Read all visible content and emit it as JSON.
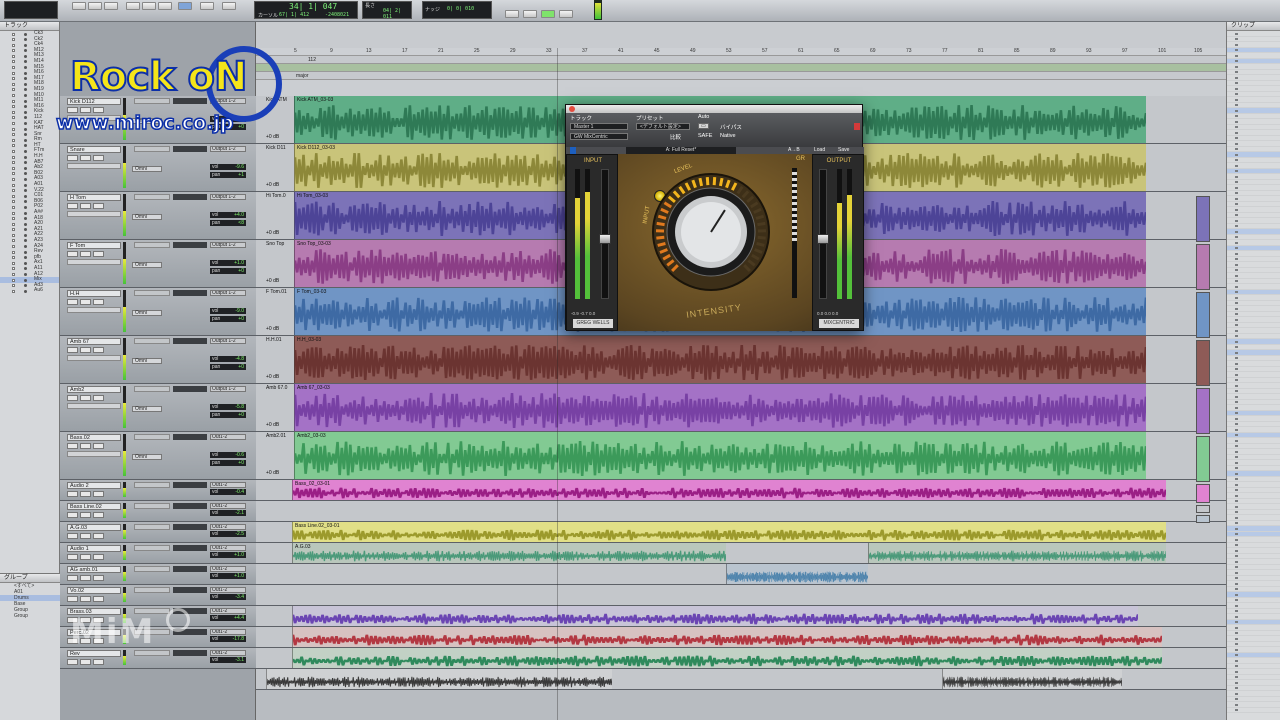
{
  "transport": {
    "counter_main": "34| 1| 047",
    "counter_label": "カーソル",
    "counter_pos": "67| 1| 412",
    "sample_value": "-2408021",
    "length_label": "長さ",
    "length_value": "04| 2| 011",
    "nudge_label": "ナッジ",
    "nudge_value": "0| 0| 010"
  },
  "panels": {
    "tracks_title": "トラック",
    "groups_title": "グループ",
    "clips_title": "クリップ"
  },
  "track_list": [
    "Ck3",
    "Ck2",
    "Ck4",
    "M12",
    "M13",
    "M14",
    "M15",
    "M16",
    "M17",
    "M18",
    "M19",
    "M10",
    "M11",
    "M16",
    "Kick",
    "112",
    "KAT",
    "HAT",
    "Snr",
    "Rm",
    "HT",
    "FTm",
    "H.H",
    "AB7",
    "Ab2",
    "B02",
    "A03",
    "A01",
    "V.22",
    "C01",
    "B06",
    "P02",
    "A##",
    "A18",
    "A20",
    "A21",
    "A22",
    "A23",
    "A24",
    "Rev",
    "pfb",
    "Ax1",
    "A11",
    "A12",
    "Mix",
    "Ad3",
    "Au6"
  ],
  "groups": [
    "<すべて>",
    "A01",
    "Drums",
    "Base",
    "Group",
    "Group"
  ],
  "strips": [
    {
      "name": "Kick D112",
      "out": "Output 1-2",
      "vol": "-11.8",
      "pan": "+0"
    },
    {
      "name": "Snare",
      "out": "Output 1-2",
      "vol": "-9.6",
      "pan": "+1"
    },
    {
      "name": "H Tom",
      "out": "Output 1-2",
      "vol": "+4.0",
      "pan": "<8"
    },
    {
      "name": "F Tom",
      "out": "Output 1-2",
      "vol": "+1.0",
      "pan": "+0"
    },
    {
      "name": "H.H",
      "out": "Output 1-2",
      "vol": "-9.0",
      "pan": "+0"
    },
    {
      "name": "Amb 67",
      "out": "Output 1-2",
      "vol": "-4.8",
      "pan": "+0"
    },
    {
      "name": "Amb2",
      "out": "Output 1-2",
      "vol": "-5.8",
      "pan": "+0"
    },
    {
      "name": "Bass.02",
      "out": "Out1-2",
      "vol": "-0.6",
      "pan": "+0"
    },
    {
      "name": "Audio 2",
      "out": "Out1-2",
      "vol": "-0.4",
      "pan": "+0"
    },
    {
      "name": "Bass Line.02",
      "out": "Out1-2",
      "vol": "-2.1",
      "pan": "+0"
    },
    {
      "name": "A.G.03",
      "out": "Out1-2",
      "vol": "-2.5",
      "pan": "+0"
    },
    {
      "name": "Audio 1",
      "out": "Out1-2",
      "vol": "+1.0",
      "pan": "100"
    },
    {
      "name": "AG amb.01",
      "out": "Out1-2",
      "vol": "+1.0",
      "pan": "100"
    },
    {
      "name": "Vo.02",
      "out": "Out1-2",
      "vol": "-3.4",
      "pan": "+0"
    },
    {
      "name": "Brass.03",
      "out": "Out1-2",
      "vol": "+4.4",
      "pan": "+0"
    },
    {
      "name": "Perc.02",
      "out": "Out1-2",
      "vol": "-17.8",
      "pan": "+0"
    },
    {
      "name": "Rev",
      "out": "Out1-2",
      "vol": "-3.1",
      "pan": "+0"
    }
  ],
  "track_clips": [
    {
      "label": "Kick ATM",
      "clip": "Kick ATM_03-03",
      "color": "#5fae87",
      "wave": "#2f7a56",
      "h": 48
    },
    {
      "label": "Kick D11",
      "clip": "Kick D112_03-03",
      "color": "#c9c47a",
      "wave": "#8d8839",
      "h": 48
    },
    {
      "label": "Hi Tom.0",
      "clip": "Hi Tom_03-03",
      "color": "#7c73b8",
      "wave": "#4d4497",
      "h": 48
    },
    {
      "label": "Sno Top",
      "clip": "Sno Top_03-03",
      "color": "#b67bb0",
      "wave": "#8b3e86",
      "h": 48
    },
    {
      "label": "F Tom.01",
      "clip": "F Tom_03-03",
      "color": "#7095c5",
      "wave": "#3e6aa4",
      "h": 48
    },
    {
      "label": "H.H.01",
      "clip": "H.H_03-03",
      "color": "#8e5b57",
      "wave": "#6b3431",
      "h": 48
    },
    {
      "label": "Amb 67.0",
      "clip": "Amb 67_03-03",
      "color": "#a472c6",
      "wave": "#7841a4",
      "h": 48
    },
    {
      "label": "Amb2.01",
      "clip": "Amb2_03-03",
      "color": "#82ca93",
      "wave": "#3c9a5a",
      "h": 48
    },
    {
      "label": "",
      "clip": "Bass_02_03-01",
      "color": "#e083d1",
      "wave": "#9b1f86",
      "h": 21
    },
    {
      "label": "",
      "clip": "",
      "color": "#c4c7cb",
      "wave": "#c4c7cb",
      "h": 21
    },
    {
      "label": "",
      "clip": "Bass Line.02_03-01",
      "color": "#e1df87",
      "wave": "#9c9a2c",
      "h": 21
    },
    {
      "label": "",
      "clip": "A.G.03",
      "color": "#b9c7bc",
      "wave": "#4b9a7a",
      "h": 21
    },
    {
      "label": "",
      "clip": "",
      "color": "#b9c4cf",
      "wave": "#3b79a6",
      "h": 21
    },
    {
      "label": "",
      "clip": "",
      "color": "#c4c7cb",
      "wave": "#c4c7cb",
      "h": 21
    },
    {
      "label": "",
      "clip": "",
      "color": "#c8c4d7",
      "wave": "#6b45b3",
      "h": 21
    },
    {
      "label": "",
      "clip": "",
      "color": "#d7c2c1",
      "wave": "#b33842",
      "h": 21
    },
    {
      "label": "",
      "clip": "",
      "color": "#c2d1c5",
      "wave": "#2f8a5c",
      "h": 21
    },
    {
      "label": "",
      "clip": "",
      "color": "#cfd1d3",
      "wave": "#3a3a3a",
      "h": 21
    }
  ],
  "ruler": {
    "bars": [
      "5",
      "9",
      "13",
      "17",
      "21",
      "25",
      "29",
      "33",
      "37",
      "41",
      "45",
      "49",
      "53",
      "57",
      "61",
      "65",
      "69",
      "73",
      "77",
      "81",
      "85",
      "89",
      "93",
      "97",
      "101",
      "105"
    ],
    "marker": "112",
    "marker2": "major"
  },
  "plugin": {
    "menu_track": "トラック",
    "menu_preset": "プリセット",
    "menu_auto": "Auto",
    "track_select": "Master 1",
    "preset_select": "<デフォルト設定>",
    "compare": "比較",
    "bypass": "バイパス",
    "safe": "SAFE",
    "native": "Native",
    "insert_name": "GW MixCentric",
    "preset_name": "A: Full Reset*",
    "load": "Load",
    "save": "Save",
    "ab": "A→B",
    "input_title": "INPUT",
    "output_title": "OUTPUT",
    "gr_title": "GR",
    "level_label": "LEVEL",
    "input_label": "INPUT",
    "intensity_label": "INTENSITY",
    "left_badge": "GREG WELLS",
    "right_badge": "MIXCENTRIC",
    "input_ticks": "-0.9  -0.7  0.0",
    "output_ticks": "0.0  0.0  0.0",
    "input_levels": [
      0.78,
      0.82
    ],
    "output_levels": [
      0.74,
      0.8
    ],
    "input_fader": 0.47,
    "output_fader": 0.47,
    "intensity": 0.62
  },
  "logo": {
    "brand": "Rock",
    "brand_o": "oN",
    "url": "www.miroc.co.jp",
    "watermark": "MiM"
  }
}
